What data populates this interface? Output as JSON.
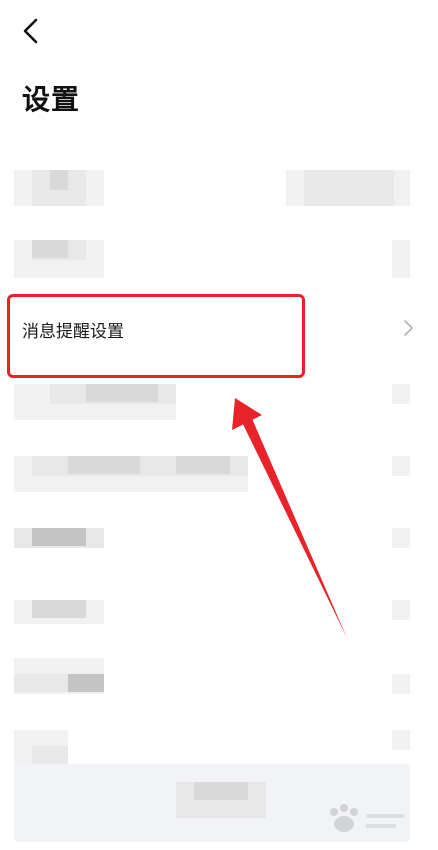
{
  "header": {
    "back_icon": "chevron-left-icon",
    "title": "设置"
  },
  "settings": {
    "message_alert_label": "消息提醒设置",
    "chevron_icon": "chevron-right-icon"
  },
  "annotation": {
    "box_color": "#e8232a",
    "arrow_color": "#e8232a"
  }
}
